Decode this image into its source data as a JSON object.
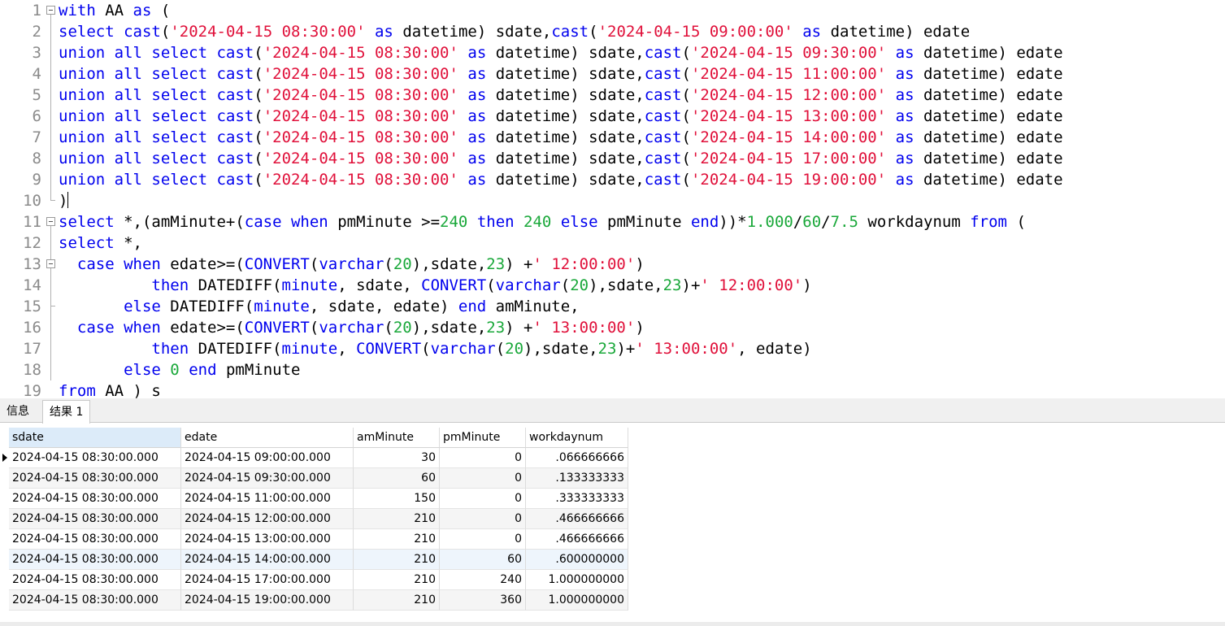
{
  "editor": {
    "lines": [
      {
        "n": "1",
        "fold": "box",
        "tokens": [
          [
            "kw",
            "with"
          ],
          [
            "op",
            " AA "
          ],
          [
            "kw",
            "as"
          ],
          [
            "op",
            " ("
          ]
        ]
      },
      {
        "n": "2",
        "fold": "line",
        "tokens": [
          [
            "kw",
            "select"
          ],
          [
            "op",
            " "
          ],
          [
            "fn",
            "cast"
          ],
          [
            "op",
            "("
          ],
          [
            "str",
            "'2024-04-15 08:30:00'"
          ],
          [
            "op",
            " "
          ],
          [
            "kw",
            "as"
          ],
          [
            "op",
            " datetime) sdate,"
          ],
          [
            "fn",
            "cast"
          ],
          [
            "op",
            "("
          ],
          [
            "str",
            "'2024-04-15 09:00:00'"
          ],
          [
            "op",
            " "
          ],
          [
            "kw",
            "as"
          ],
          [
            "op",
            " datetime) edate"
          ]
        ]
      },
      {
        "n": "3",
        "fold": "line",
        "tokens": [
          [
            "kw",
            "union all select"
          ],
          [
            "op",
            " "
          ],
          [
            "fn",
            "cast"
          ],
          [
            "op",
            "("
          ],
          [
            "str",
            "'2024-04-15 08:30:00'"
          ],
          [
            "op",
            " "
          ],
          [
            "kw",
            "as"
          ],
          [
            "op",
            " datetime) sdate,"
          ],
          [
            "fn",
            "cast"
          ],
          [
            "op",
            "("
          ],
          [
            "str",
            "'2024-04-15 09:30:00'"
          ],
          [
            "op",
            " "
          ],
          [
            "kw",
            "as"
          ],
          [
            "op",
            " datetime) edate"
          ]
        ]
      },
      {
        "n": "4",
        "fold": "line",
        "tokens": [
          [
            "kw",
            "union all select"
          ],
          [
            "op",
            " "
          ],
          [
            "fn",
            "cast"
          ],
          [
            "op",
            "("
          ],
          [
            "str",
            "'2024-04-15 08:30:00'"
          ],
          [
            "op",
            " "
          ],
          [
            "kw",
            "as"
          ],
          [
            "op",
            " datetime) sdate,"
          ],
          [
            "fn",
            "cast"
          ],
          [
            "op",
            "("
          ],
          [
            "str",
            "'2024-04-15 11:00:00'"
          ],
          [
            "op",
            " "
          ],
          [
            "kw",
            "as"
          ],
          [
            "op",
            " datetime) edate"
          ]
        ]
      },
      {
        "n": "5",
        "fold": "line",
        "tokens": [
          [
            "kw",
            "union all select"
          ],
          [
            "op",
            " "
          ],
          [
            "fn",
            "cast"
          ],
          [
            "op",
            "("
          ],
          [
            "str",
            "'2024-04-15 08:30:00'"
          ],
          [
            "op",
            " "
          ],
          [
            "kw",
            "as"
          ],
          [
            "op",
            " datetime) sdate,"
          ],
          [
            "fn",
            "cast"
          ],
          [
            "op",
            "("
          ],
          [
            "str",
            "'2024-04-15 12:00:00'"
          ],
          [
            "op",
            " "
          ],
          [
            "kw",
            "as"
          ],
          [
            "op",
            " datetime) edate"
          ]
        ]
      },
      {
        "n": "6",
        "fold": "line",
        "tokens": [
          [
            "kw",
            "union all select"
          ],
          [
            "op",
            " "
          ],
          [
            "fn",
            "cast"
          ],
          [
            "op",
            "("
          ],
          [
            "str",
            "'2024-04-15 08:30:00'"
          ],
          [
            "op",
            " "
          ],
          [
            "kw",
            "as"
          ],
          [
            "op",
            " datetime) sdate,"
          ],
          [
            "fn",
            "cast"
          ],
          [
            "op",
            "("
          ],
          [
            "str",
            "'2024-04-15 13:00:00'"
          ],
          [
            "op",
            " "
          ],
          [
            "kw",
            "as"
          ],
          [
            "op",
            " datetime) edate"
          ]
        ]
      },
      {
        "n": "7",
        "fold": "line",
        "tokens": [
          [
            "kw",
            "union all select"
          ],
          [
            "op",
            " "
          ],
          [
            "fn",
            "cast"
          ],
          [
            "op",
            "("
          ],
          [
            "str",
            "'2024-04-15 08:30:00'"
          ],
          [
            "op",
            " "
          ],
          [
            "kw",
            "as"
          ],
          [
            "op",
            " datetime) sdate,"
          ],
          [
            "fn",
            "cast"
          ],
          [
            "op",
            "("
          ],
          [
            "str",
            "'2024-04-15 14:00:00'"
          ],
          [
            "op",
            " "
          ],
          [
            "kw",
            "as"
          ],
          [
            "op",
            " datetime) edate"
          ]
        ]
      },
      {
        "n": "8",
        "fold": "line",
        "tokens": [
          [
            "kw",
            "union all select"
          ],
          [
            "op",
            " "
          ],
          [
            "fn",
            "cast"
          ],
          [
            "op",
            "("
          ],
          [
            "str",
            "'2024-04-15 08:30:00'"
          ],
          [
            "op",
            " "
          ],
          [
            "kw",
            "as"
          ],
          [
            "op",
            " datetime) sdate,"
          ],
          [
            "fn",
            "cast"
          ],
          [
            "op",
            "("
          ],
          [
            "str",
            "'2024-04-15 17:00:00'"
          ],
          [
            "op",
            " "
          ],
          [
            "kw",
            "as"
          ],
          [
            "op",
            " datetime) edate"
          ]
        ]
      },
      {
        "n": "9",
        "fold": "line",
        "tokens": [
          [
            "kw",
            "union all select"
          ],
          [
            "op",
            " "
          ],
          [
            "fn",
            "cast"
          ],
          [
            "op",
            "("
          ],
          [
            "str",
            "'2024-04-15 08:30:00'"
          ],
          [
            "op",
            " "
          ],
          [
            "kw",
            "as"
          ],
          [
            "op",
            " datetime) sdate,"
          ],
          [
            "fn",
            "cast"
          ],
          [
            "op",
            "("
          ],
          [
            "str",
            "'2024-04-15 19:00:00'"
          ],
          [
            "op",
            " "
          ],
          [
            "kw",
            "as"
          ],
          [
            "op",
            " datetime) edate"
          ]
        ]
      },
      {
        "n": "10",
        "fold": "end",
        "tokens": [
          [
            "op",
            ")"
          ]
        ]
      },
      {
        "n": "11",
        "fold": "box",
        "tokens": [
          [
            "kw",
            "select"
          ],
          [
            "op",
            " *,(amMinute+("
          ],
          [
            "kw",
            "case when"
          ],
          [
            "op",
            " pmMinute >="
          ],
          [
            "num",
            "240"
          ],
          [
            "op",
            " "
          ],
          [
            "kw",
            "then"
          ],
          [
            "op",
            " "
          ],
          [
            "num",
            "240"
          ],
          [
            "op",
            " "
          ],
          [
            "kw",
            "else"
          ],
          [
            "op",
            " pmMinute "
          ],
          [
            "kw",
            "end"
          ],
          [
            "op",
            "))*"
          ],
          [
            "num",
            "1.000"
          ],
          [
            "op",
            "/"
          ],
          [
            "num",
            "60"
          ],
          [
            "op",
            "/"
          ],
          [
            "num",
            "7.5"
          ],
          [
            "op",
            " workdaynum "
          ],
          [
            "kw",
            "from"
          ],
          [
            "op",
            " ("
          ]
        ]
      },
      {
        "n": "12",
        "fold": "line",
        "tokens": [
          [
            "kw",
            "select"
          ],
          [
            "op",
            " *,"
          ]
        ]
      },
      {
        "n": "13",
        "fold": "boxline",
        "tokens": [
          [
            "op",
            "  "
          ],
          [
            "kw",
            "case when"
          ],
          [
            "op",
            " edate>=("
          ],
          [
            "fn",
            "CONVERT"
          ],
          [
            "op",
            "("
          ],
          [
            "fn",
            "varchar"
          ],
          [
            "op",
            "("
          ],
          [
            "num",
            "20"
          ],
          [
            "op",
            "),sdate,"
          ],
          [
            "num",
            "23"
          ],
          [
            "op",
            ") +"
          ],
          [
            "str",
            "' 12:00:00'"
          ],
          [
            "op",
            ")"
          ]
        ]
      },
      {
        "n": "14",
        "fold": "line",
        "tokens": [
          [
            "op",
            "          "
          ],
          [
            "kw",
            "then"
          ],
          [
            "op",
            " DATEDIFF("
          ],
          [
            "fn",
            "minute"
          ],
          [
            "op",
            ", sdate, "
          ],
          [
            "fn",
            "CONVERT"
          ],
          [
            "op",
            "("
          ],
          [
            "fn",
            "varchar"
          ],
          [
            "op",
            "("
          ],
          [
            "num",
            "20"
          ],
          [
            "op",
            "),sdate,"
          ],
          [
            "num",
            "23"
          ],
          [
            "op",
            ")+"
          ],
          [
            "str",
            "' 12:00:00'"
          ],
          [
            "op",
            ")"
          ]
        ]
      },
      {
        "n": "15",
        "fold": "endline",
        "tokens": [
          [
            "op",
            "       "
          ],
          [
            "kw",
            "else"
          ],
          [
            "op",
            " DATEDIFF("
          ],
          [
            "fn",
            "minute"
          ],
          [
            "op",
            ", sdate, edate) "
          ],
          [
            "kw",
            "end"
          ],
          [
            "op",
            " amMinute,"
          ]
        ]
      },
      {
        "n": "16",
        "fold": "line",
        "tokens": [
          [
            "op",
            "  "
          ],
          [
            "kw",
            "case when"
          ],
          [
            "op",
            " edate>=("
          ],
          [
            "fn",
            "CONVERT"
          ],
          [
            "op",
            "("
          ],
          [
            "fn",
            "varchar"
          ],
          [
            "op",
            "("
          ],
          [
            "num",
            "20"
          ],
          [
            "op",
            "),sdate,"
          ],
          [
            "num",
            "23"
          ],
          [
            "op",
            ") +"
          ],
          [
            "str",
            "' 13:00:00'"
          ],
          [
            "op",
            ")"
          ]
        ]
      },
      {
        "n": "17",
        "fold": "line",
        "tokens": [
          [
            "op",
            "          "
          ],
          [
            "kw",
            "then"
          ],
          [
            "op",
            " DATEDIFF("
          ],
          [
            "fn",
            "minute"
          ],
          [
            "op",
            ", "
          ],
          [
            "fn",
            "CONVERT"
          ],
          [
            "op",
            "("
          ],
          [
            "fn",
            "varchar"
          ],
          [
            "op",
            "("
          ],
          [
            "num",
            "20"
          ],
          [
            "op",
            "),sdate,"
          ],
          [
            "num",
            "23"
          ],
          [
            "op",
            ")+"
          ],
          [
            "str",
            "' 13:00:00'"
          ],
          [
            "op",
            ", edate)"
          ]
        ]
      },
      {
        "n": "18",
        "fold": "line",
        "tokens": [
          [
            "op",
            "       "
          ],
          [
            "kw",
            "else"
          ],
          [
            "op",
            " "
          ],
          [
            "num",
            "0"
          ],
          [
            "op",
            " "
          ],
          [
            "kw",
            "end"
          ],
          [
            "op",
            " pmMinute"
          ]
        ]
      },
      {
        "n": "19",
        "fold": "line",
        "tokens": [
          [
            "kw",
            "from"
          ],
          [
            "op",
            " AA ) s"
          ]
        ]
      }
    ]
  },
  "tabs": [
    {
      "label": "信息",
      "active": false
    },
    {
      "label": "结果 1",
      "active": true
    }
  ],
  "grid": {
    "columns": [
      "sdate",
      "edate",
      "amMinute",
      "pmMinute",
      "workdaynum"
    ],
    "rows": [
      [
        "2024-04-15 08:30:00.000",
        "2024-04-15 09:00:00.000",
        "30",
        "0",
        ".066666666"
      ],
      [
        "2024-04-15 08:30:00.000",
        "2024-04-15 09:30:00.000",
        "60",
        "0",
        ".133333333"
      ],
      [
        "2024-04-15 08:30:00.000",
        "2024-04-15 11:00:00.000",
        "150",
        "0",
        ".333333333"
      ],
      [
        "2024-04-15 08:30:00.000",
        "2024-04-15 12:00:00.000",
        "210",
        "0",
        ".466666666"
      ],
      [
        "2024-04-15 08:30:00.000",
        "2024-04-15 13:00:00.000",
        "210",
        "0",
        ".466666666"
      ],
      [
        "2024-04-15 08:30:00.000",
        "2024-04-15 14:00:00.000",
        "210",
        "60",
        ".600000000"
      ],
      [
        "2024-04-15 08:30:00.000",
        "2024-04-15 17:00:00.000",
        "210",
        "240",
        "1.000000000"
      ],
      [
        "2024-04-15 08:30:00.000",
        "2024-04-15 19:00:00.000",
        "210",
        "360",
        "1.000000000"
      ]
    ],
    "current_row": 0,
    "highlight_row": 5
  }
}
